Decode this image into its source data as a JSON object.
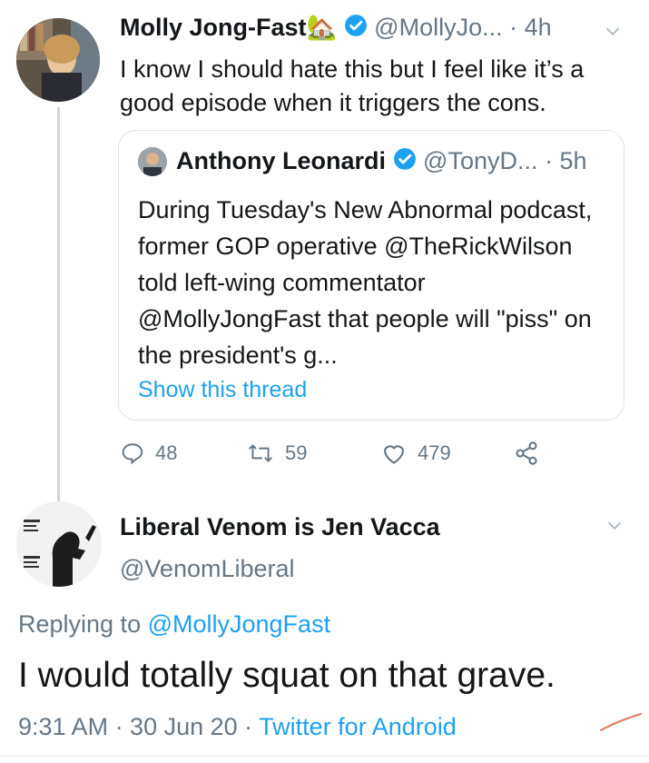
{
  "tweet": {
    "name": "Molly Jong-Fast",
    "name_emoji": "🏡",
    "handle": "@MollyJo...",
    "time": "· 4h",
    "text": "I know I should hate this but I feel like it’s a good episode when it triggers the cons."
  },
  "quote": {
    "name": "Anthony Leonardi",
    "handle": "@TonyD...",
    "time": "· 5h",
    "text": "During Tuesday's New Abnormal podcast, former GOP operative @TheRickWilson told left-wing commentator @MollyJongFast  that people will \"piss\" on the president's g...",
    "show_thread": "Show this thread"
  },
  "actions": {
    "replies": "48",
    "retweets": "59",
    "likes": "479"
  },
  "reply": {
    "name": "Liberal Venom is Jen Vacca",
    "handle": "@VenomLiberal",
    "replying_prefix": "Replying to ",
    "replying_handle": "@MollyJongFast",
    "text": "I would totally squat on that grave.",
    "time": "9:31 AM · 30 Jun 20 · ",
    "source": "Twitter for Android"
  },
  "colors": {
    "accent": "#1da1f2",
    "muted": "#657786",
    "text": "#14171a"
  }
}
